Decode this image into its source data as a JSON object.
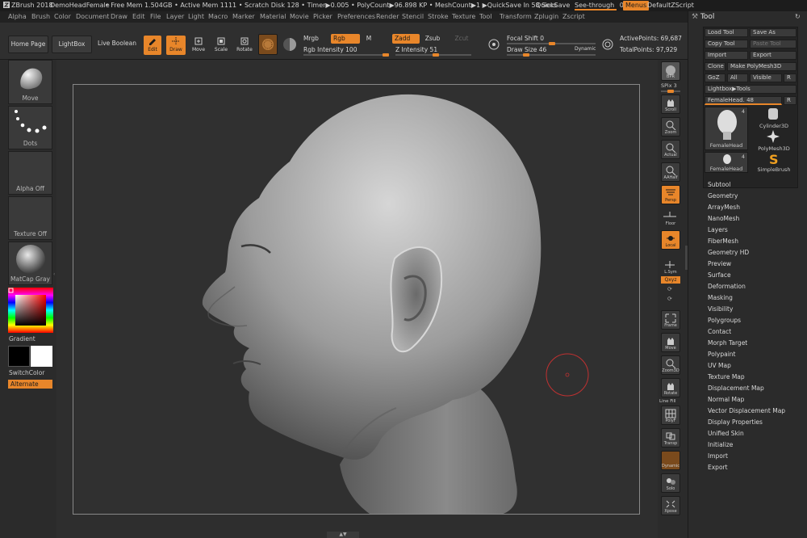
{
  "titlebar": {
    "app": "ZBrush 2018",
    "doc": "DemoHeadFemale",
    "stats": "• Free Mem 1.504GB • Active Mem 1111 • Scratch Disk 128 • Timer▶0.005 • PolyCount▶96.898 KP • MeshCount▶1 ▶QuickSave In 58 Secs",
    "quicksave": "QuickSave",
    "seethrough": "See-through",
    "seethrough_value": "0",
    "menus": "Menus",
    "script": "DefaultZScript"
  },
  "menubar": [
    "Alpha",
    "Brush",
    "Color",
    "Document",
    "Draw",
    "Edit",
    "File",
    "Layer",
    "Light",
    "Macro",
    "Marker",
    "Material",
    "Movie",
    "Picker",
    "Preferences",
    "Render",
    "Stencil",
    "Stroke",
    "Texture",
    "Tool",
    "Transform",
    "Zplugin",
    "Zscript"
  ],
  "toolbar": {
    "home": "Home Page",
    "lightbox": "LightBox",
    "liveboolean": "Live Boolean",
    "edit": "Edit",
    "draw": "Draw",
    "move": "Move",
    "scale": "Scale",
    "rotate": "Rotate",
    "mrgb": "Mrgb",
    "rgb": "Rgb",
    "m": "M",
    "zadd": "Zadd",
    "zsub": "Zsub",
    "zcut": "Zcut",
    "rgb_intensity": "Rgb Intensity 100",
    "z_intensity": "Z Intensity 51",
    "focal_shift": "Focal Shift 0",
    "draw_size": "Draw Size 46",
    "dynamic": "Dynamic",
    "active_points": "ActivePoints: 69,687",
    "total_points": "TotalPoints: 97,929"
  },
  "left": {
    "move": "Move",
    "dots": "Dots",
    "alpha": "Alpha Off",
    "texture": "Texture Off",
    "matcap": "MatCap Gray",
    "gradient": "Gradient",
    "switchcolor": "SwitchColor",
    "alternate": "Alternate"
  },
  "right": {
    "bpr": "BPR",
    "spix": "SPix 3",
    "scroll": "Scroll",
    "zoom": "Zoom",
    "actual": "Actual",
    "aahalf": "AAHalf",
    "persp": "Persp",
    "floor": "Floor",
    "local": "Local",
    "lsym": "L.Sym",
    "xyz": "Qxyz",
    "frame": "Frame",
    "move": "Move",
    "zoom3d": "Zoom3D",
    "rotate": "Rotate",
    "linefill": "Line Fill",
    "polyf": "PolyF",
    "transp": "Transp",
    "dynamic": "Dynamic",
    "solo": "Solo",
    "xpose": "Xpose"
  },
  "tool": {
    "title": "Tool",
    "load": "Load Tool",
    "saveas": "Save As",
    "copy": "Copy Tool",
    "paste": "Paste Tool",
    "import": "Import",
    "export": "Export",
    "clone": "Clone",
    "makepoly": "Make PolyMesh3D",
    "goz": "GoZ",
    "all": "All",
    "visible": "Visible",
    "r": "R",
    "lightbox_tools": "Lightbox▶Tools",
    "current": "FemaleHead. 48",
    "thumbs": [
      {
        "name": "FemaleHead",
        "count": "4"
      },
      {
        "name": "Cylinder3D",
        "count": ""
      },
      {
        "name": "PolyMesh3D",
        "count": ""
      },
      {
        "name": "FemaleHead",
        "count": "4"
      },
      {
        "name": "SimpleBrush",
        "count": ""
      }
    ],
    "sections": [
      "Subtool",
      "Geometry",
      "ArrayMesh",
      "NanoMesh",
      "Layers",
      "FiberMesh",
      "Geometry HD",
      "Preview",
      "Surface",
      "Deformation",
      "Masking",
      "Visibility",
      "Polygroups",
      "Contact",
      "Morph Target",
      "Polypaint",
      "UV Map",
      "Texture Map",
      "Displacement Map",
      "Normal Map",
      "Vector Displacement Map",
      "Display Properties",
      "Unified Skin",
      "Initialize",
      "Import",
      "Export"
    ]
  },
  "colors": {
    "accent": "#e8862a",
    "bg": "#2b2b2b",
    "cursor": "#c03030"
  }
}
